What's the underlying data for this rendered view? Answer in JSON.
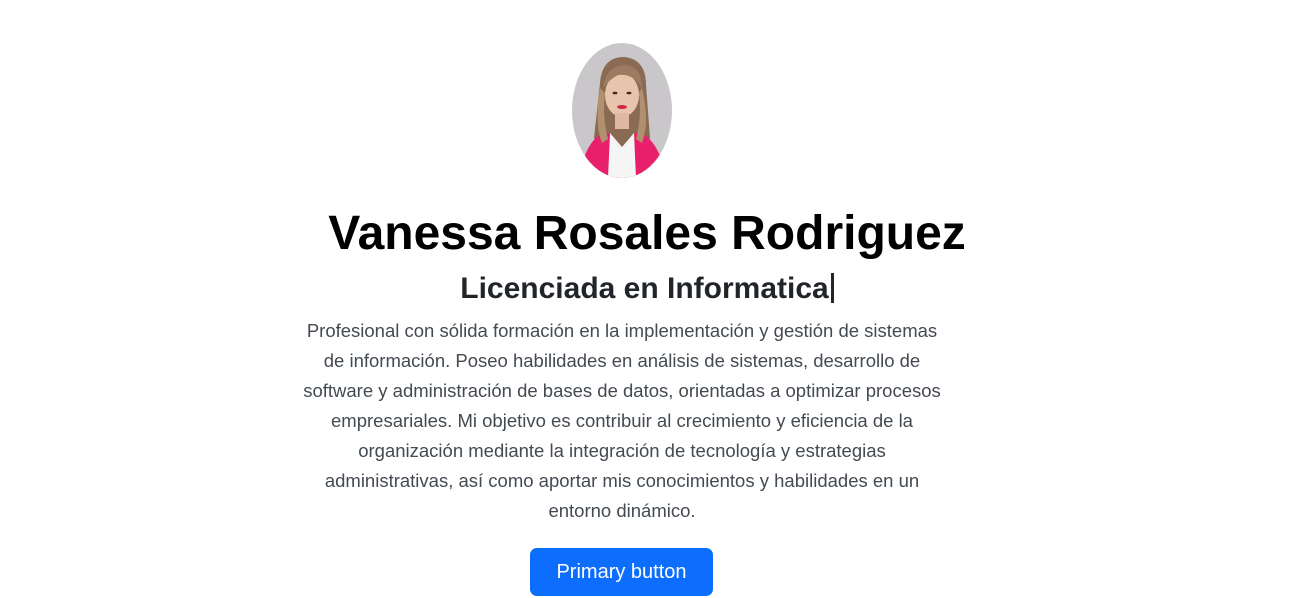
{
  "profile": {
    "avatar_icon": "profile-photo",
    "name": "Vanessa Rosales Rodriguez",
    "title": "Licenciada en Informatica",
    "description": "Profesional con sólida formación en la implementación y gestión de sistemas de información. Poseo habilidades en análisis de sistemas, desarrollo de software y administración de bases de datos, orientadas a optimizar procesos empresariales. Mi objetivo es contribuir al crecimiento y eficiencia de la organización mediante la integración de tecnología y estrategias administrativas, así como aportar mis conocimientos y habilidades en un entorno dinámico."
  },
  "actions": {
    "primary_label": "Primary button"
  },
  "colors": {
    "primary": "#0d6efd",
    "text": "#000000",
    "muted_text": "#444a52",
    "accent_pink": "#e8206b"
  }
}
